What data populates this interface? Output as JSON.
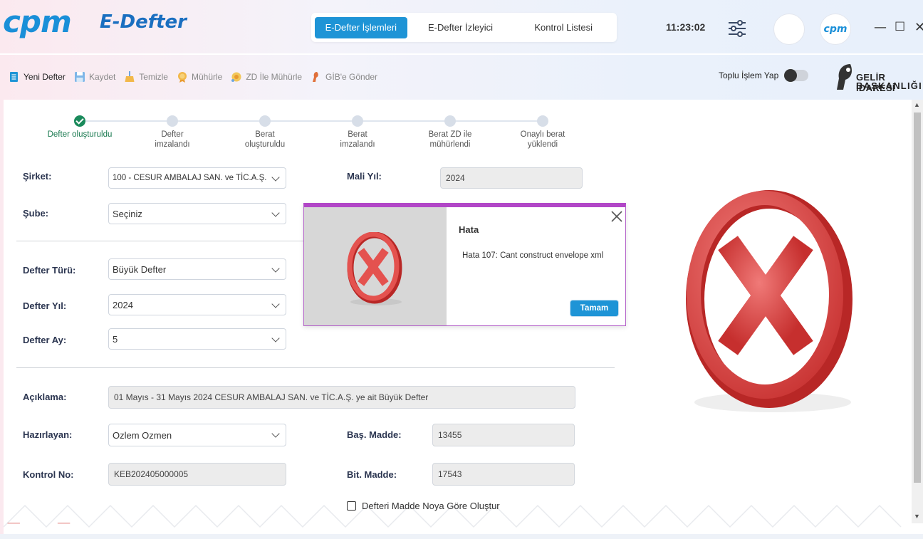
{
  "header": {
    "logo": "cpm",
    "app_name": "E-Defter",
    "tabs": [
      "E-Defter İşlemleri",
      "E-Defter İzleyici",
      "Kontrol Listesi"
    ],
    "clock": "11:23:02",
    "avatar_text": "cpm",
    "window_controls": {
      "minimize": "—",
      "maximize": "☐",
      "close": "✕"
    }
  },
  "toolbar": {
    "items": [
      "Yeni Defter",
      "Kaydet",
      "Temizle",
      "Mühürle",
      "ZD İle Mühürle",
      "GİB'e Gönder"
    ],
    "bulk_label": "Toplu İşlem Yap",
    "bulk_toggle_on": false
  },
  "gib": {
    "line1": "GELİR İDARESİ",
    "line2": "BAŞKANLIĞI"
  },
  "stepper": {
    "steps": [
      {
        "label1": "Defter oluşturuldu",
        "label2": "",
        "done": true
      },
      {
        "label1": "Defter",
        "label2": "imzalandı",
        "done": false
      },
      {
        "label1": "Berat",
        "label2": "oluşturuldu",
        "done": false
      },
      {
        "label1": "Berat",
        "label2": "imzalandı",
        "done": false
      },
      {
        "label1": "Berat ZD ile",
        "label2": "mühürlendi",
        "done": false
      },
      {
        "label1": "Onaylı berat",
        "label2": "yüklendi",
        "done": false
      }
    ]
  },
  "form": {
    "sirket_label": "Şirket:",
    "sirket_value": "100 - CESUR AMBALAJ SAN. ve TİC.A.Ş.",
    "mali_yil_label": "Mali Yıl:",
    "mali_yil_value": "2024",
    "sube_label": "Şube:",
    "sube_value": "Seçiniz",
    "defter_turu_label": "Defter Türü:",
    "defter_turu_value": "Büyük Defter",
    "defter_yil_label": "Defter Yıl:",
    "defter_yil_value": "2024",
    "defter_ay_label": "Defter Ay:",
    "defter_ay_value": "5",
    "aciklama_label": "Açıklama:",
    "aciklama_value": "01 Mayıs - 31 Mayıs 2024 CESUR AMBALAJ SAN. ve TİC.A.Ş. ye ait Büyük Defter",
    "hazirlayan_label": "Hazırlayan:",
    "hazirlayan_value": "Ozlem Ozmen",
    "bas_madde_label": "Baş. Madde:",
    "bas_madde_value": "13455",
    "kontrol_no_label": "Kontrol No:",
    "kontrol_no_value": "KEB202405000005",
    "bit_madde_label": "Bit. Madde:",
    "bit_madde_value": "17543",
    "madde_checkbox_label": "Defteri Madde Noya Göre Oluştur",
    "madde_checkbox_checked": false
  },
  "dialog": {
    "title": "Hata",
    "message": "Hata 107: Cant construct envelope xml",
    "ok_label": "Tamam"
  },
  "colors": {
    "accent": "#1e94d6",
    "dialog_border": "#b146c7",
    "error_red": "#e0403f",
    "step_done": "#1a8a5b"
  }
}
